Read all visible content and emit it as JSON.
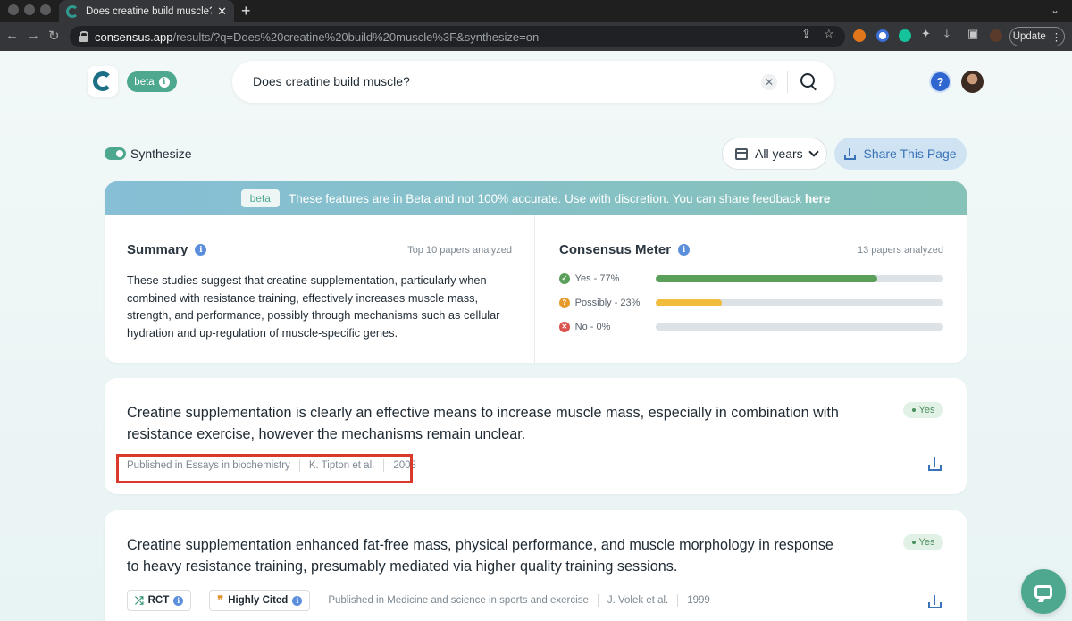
{
  "browser": {
    "tab_title": "Does creatine build muscle? - C",
    "url_host": "consensus.app",
    "url_path": "/results/?q=Does%20creatine%20build%20muscle%3F&synthesize=on",
    "update_label": "Update"
  },
  "header": {
    "beta_label": "beta",
    "search_value": "Does creatine build muscle?",
    "help_label": "?"
  },
  "controls": {
    "synthesize_label": "Synthesize",
    "years_label": "All years",
    "share_label": "Share This Page"
  },
  "banner": {
    "pill": "beta",
    "text": "These features are in Beta and not 100% accurate. Use with discretion. You can share feedback",
    "link": "here"
  },
  "summary": {
    "title": "Summary",
    "meta": "Top 10 papers analyzed",
    "text": "These studies suggest that creatine supplementation, particularly when combined with resistance training, effectively increases muscle mass, strength, and performance, possibly through mechanisms such as cellular hydration and up-regulation of muscle-specific genes."
  },
  "meter": {
    "title": "Consensus Meter",
    "meta": "13 papers analyzed",
    "rows": [
      {
        "label": "Yes - 77%",
        "percent": 77,
        "color": "#5aa05a",
        "icon_color": "#5aa05a",
        "icon": "check-icon"
      },
      {
        "label": "Possibly - 23%",
        "percent": 23,
        "color": "#f1bb3c",
        "icon_color": "#e69a2b",
        "icon": "question-icon"
      },
      {
        "label": "No - 0%",
        "percent": 0,
        "color": "#d9534f",
        "icon_color": "#d9534f",
        "icon": "x-icon"
      }
    ]
  },
  "results": [
    {
      "claim": "Creatine supplementation is clearly an effective means to increase muscle mass, especially in combination with resistance exercise, however the mechanisms remain unclear.",
      "verdict": "Yes",
      "journal": "Published in Essays in biochemistry",
      "authors": "K. Tipton et al.",
      "year": "2008"
    },
    {
      "claim": "Creatine supplementation enhanced fat-free mass, physical performance, and muscle morphology in response to heavy resistance training, presumably mediated via higher quality training sessions.",
      "verdict": "Yes",
      "tags": [
        "RCT",
        "Highly Cited"
      ],
      "journal": "Published in Medicine and science in sports and exercise",
      "authors": "J. Volek et al.",
      "year": "1999"
    }
  ]
}
